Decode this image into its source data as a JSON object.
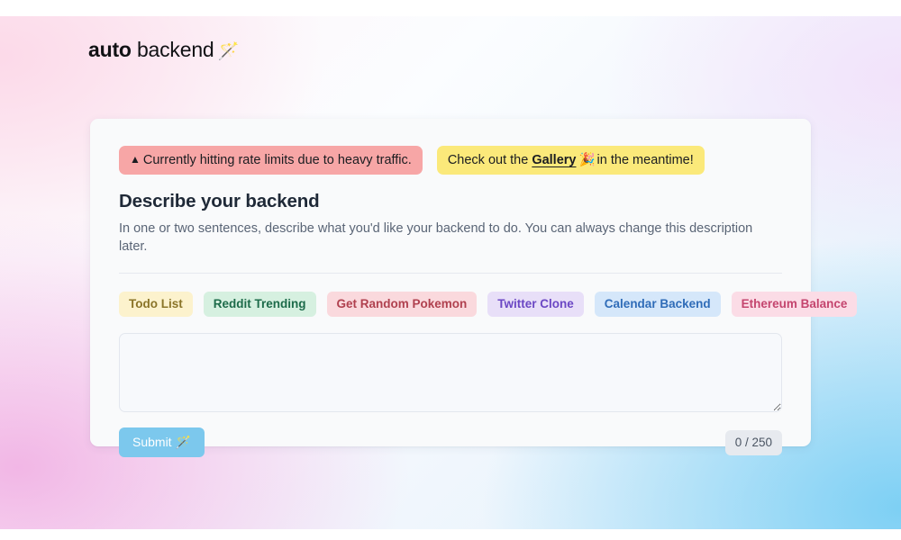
{
  "header": {
    "logo_strong": "auto",
    "logo_rest": " backend",
    "logo_icon": "🪄",
    "logo_icon_name": "magic-wand-icon"
  },
  "banners": {
    "warning": {
      "icon": "▲",
      "icon_name": "warning-triangle-icon",
      "text": "Currently hitting rate limits due to heavy traffic.",
      "bg_color": "#f7a6a6"
    },
    "gallery": {
      "prefix": "Check out the ",
      "link_label": "Gallery",
      "icon": "🎉",
      "icon_name": "party-popper-icon",
      "suffix": "in the meantime!",
      "bg_color": "#fbe97a"
    }
  },
  "main": {
    "heading": "Describe your backend",
    "subtitle": "In one or two sentences, describe what you'd like your backend to do. You can always change this description later.",
    "chips": [
      {
        "label": "Todo List",
        "bg": "#fcf2cd",
        "fg": "#8a7428"
      },
      {
        "label": "Reddit Trending",
        "bg": "#d6f0e0",
        "fg": "#1d6b4a"
      },
      {
        "label": "Get Random Pokemon",
        "bg": "#fad9dd",
        "fg": "#b0414f"
      },
      {
        "label": "Twitter Clone",
        "bg": "#e8dff8",
        "fg": "#6b47c4"
      },
      {
        "label": "Calendar Backend",
        "bg": "#d5e7fa",
        "fg": "#2f6cb8"
      },
      {
        "label": "Ethereum Balance",
        "bg": "#fbdce6",
        "fg": "#c4456e"
      }
    ],
    "textarea": {
      "value": "",
      "placeholder": ""
    },
    "submit_label": "Submit",
    "submit_icon": "🪄",
    "submit_color": "#7cc8ed",
    "char_counter": "0 / 250"
  }
}
